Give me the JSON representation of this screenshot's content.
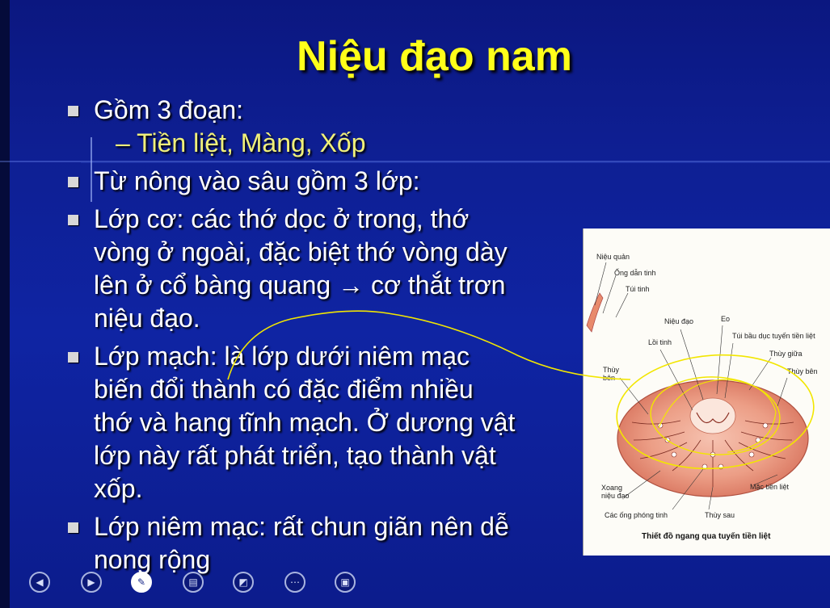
{
  "slide": {
    "title": "Niệu đạo nam",
    "bullets": [
      {
        "text": "Gồm 3 đoạn:"
      },
      {
        "sub": "– Tiền liệt, Màng, Xốp"
      },
      {
        "text": "Từ nông vào sâu gồm 3 lớp:"
      },
      {
        "lines": [
          "Lớp cơ: các thớ dọc ở trong, thớ",
          "vòng ở ngoài, đặc biệt thớ vòng dày",
          "lên ở cổ bàng quang → cơ thắt trơn",
          "niệu đạo."
        ]
      },
      {
        "lines": [
          "Lớp mạch: là lớp dưới niêm mạc",
          "biến đổi thành có đặc điểm nhiều",
          "thớ và hang tĩnh mạch. Ở dương vật",
          "lớp này rất phát triển, tạo thành vật",
          "xốp."
        ]
      },
      {
        "lines": [
          "Lớp niêm mạc: rất chun giãn nên dễ",
          "nong rộng"
        ]
      }
    ]
  },
  "figure": {
    "labels": {
      "nieu_quan": "Niệu quản",
      "ong_dan_tinh": "Ống dẫn tinh",
      "tui_tinh": "Túi tinh",
      "nieu_dao": "Niệu đạo",
      "eo": "Eo",
      "loi_tinh": "Lồi tinh",
      "tui_bau_duc": "Túi bầu dục tuyến tiền liệt",
      "thuy_giua": "Thùy giữa",
      "thuy_ben_left": "Thùy bên",
      "thuy_ben_right": "Thùy bên",
      "xoang_nieu_dao": "Xoang niệu đạo",
      "mac_tien_liet": "Mặc tiền liệt",
      "cac_ong_phong_tinh": "Các ống phóng tinh",
      "thuy_sau": "Thùy sau"
    },
    "caption": "Thiết đồ ngang qua tuyến tiền liệt"
  },
  "toolbar": [
    {
      "name": "previous-slide-button",
      "icon": "◀"
    },
    {
      "name": "next-slide-button",
      "icon": "▶"
    },
    {
      "name": "pen-tool-button",
      "icon": "✎"
    },
    {
      "name": "slides-overview-button",
      "icon": "▤"
    },
    {
      "name": "pointer-options-button",
      "icon": "◩"
    },
    {
      "name": "more-options-button",
      "icon": "⋯"
    },
    {
      "name": "display-settings-button",
      "icon": "▣"
    }
  ],
  "colors": {
    "title": "#ffff1a",
    "sub_bullet": "#f0f07a",
    "body_text": "#ffffff",
    "annotation_ink": "#f2e600",
    "background": "#0f24a3"
  }
}
